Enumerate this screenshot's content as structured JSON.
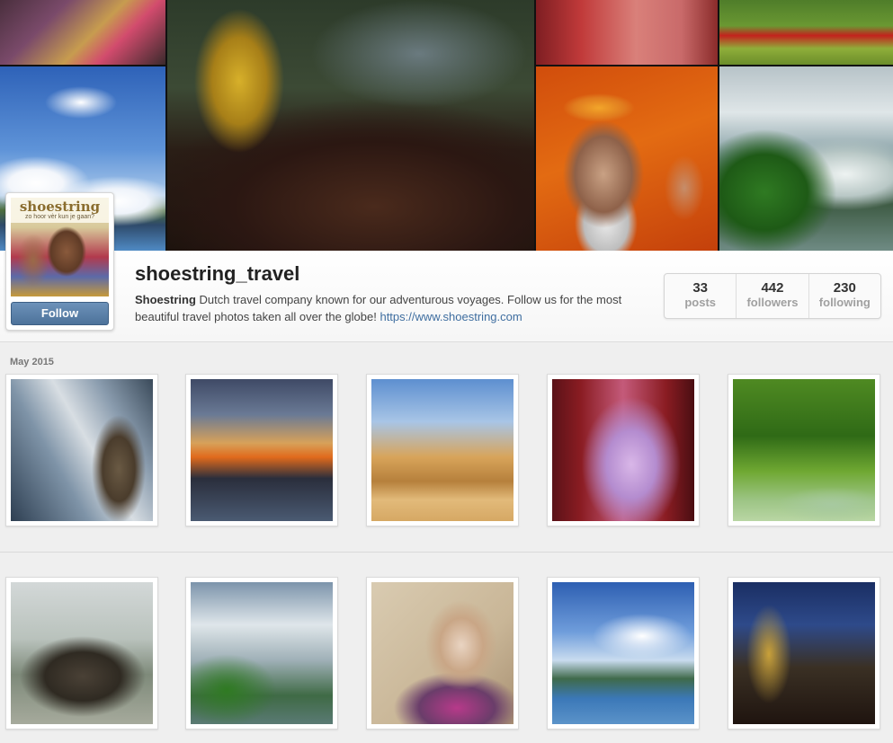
{
  "profile": {
    "brand_logo": "shoestring",
    "brand_tagline": "zo hoor vèr kun je gaan?",
    "follow_label": "Follow",
    "username": "shoestring_travel",
    "bio_name": "Shoestring",
    "bio_text": " Dutch travel company known for our adventurous voyages. Follow us for the most beautiful travel photos taken all over the globe! ",
    "bio_link": "https://www.shoestring.com"
  },
  "stats": [
    {
      "value": "33",
      "label": "posts"
    },
    {
      "value": "442",
      "label": "followers"
    },
    {
      "value": "230",
      "label": "following"
    }
  ],
  "feed": {
    "section_label": "May 2015"
  },
  "colors": {
    "follow_button": "#5a7fa7",
    "link": "#3f6ea0",
    "background": "#efefef"
  }
}
